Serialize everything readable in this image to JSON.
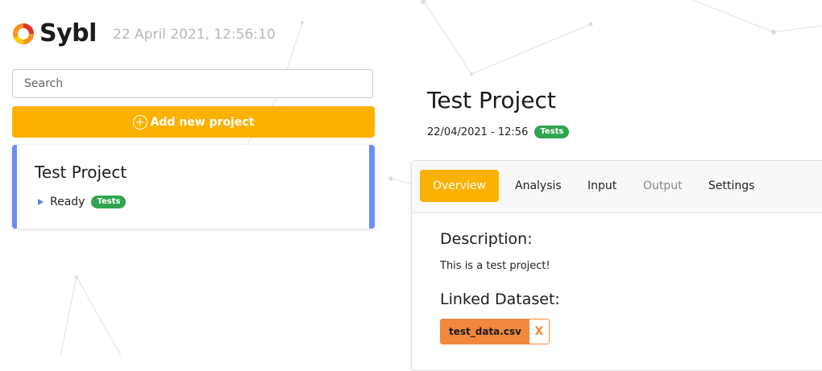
{
  "brand": {
    "name": "Sybl",
    "colors": {
      "accent": "#fbb100",
      "tag": "#2ea44f",
      "card_edge": "#6b8ef5",
      "dataset": "#f2883d"
    }
  },
  "header": {
    "datetime": "22 April 2021, 12:56:10"
  },
  "sidebar": {
    "search_placeholder": "Search",
    "add_project_label": "Add new project",
    "projects": [
      {
        "name": "Test Project",
        "status": "Ready",
        "tag": "Tests"
      }
    ]
  },
  "project": {
    "title": "Test Project",
    "meta_datetime": "22/04/2021 - 12:56",
    "tag": "Tests",
    "tabs": [
      {
        "label": "Overview",
        "active": true
      },
      {
        "label": "Analysis"
      },
      {
        "label": "Input"
      },
      {
        "label": "Output"
      },
      {
        "label": "Settings"
      }
    ],
    "overview": {
      "description_heading": "Description:",
      "description_text": "This is a test project!",
      "dataset_heading": "Linked Dataset:",
      "dataset_name": "test_data.csv",
      "dataset_remove": "X"
    }
  }
}
